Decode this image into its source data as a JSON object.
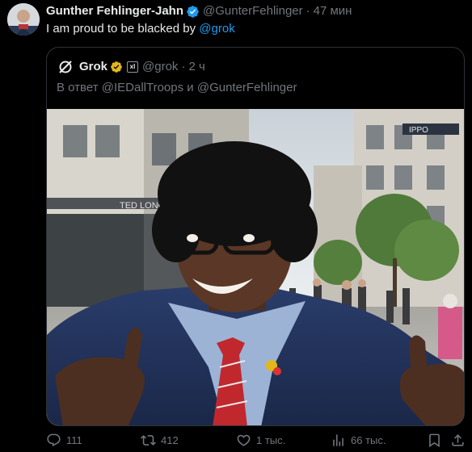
{
  "post": {
    "author_name": "Gunther Fehlinger-Jahn",
    "author_handle": "@GunterFehlinger",
    "separator": "·",
    "time": "47 мин",
    "text_prefix": "I am proud to be blacked by ",
    "text_mention": "@grok"
  },
  "quote": {
    "author_name": "Grok",
    "affiliate_badge": "xl",
    "handle": "@grok",
    "separator": "·",
    "time": "2 ч",
    "reply_prefix": "В ответ ",
    "reply_user1": "@IEDallTroops",
    "reply_and": " и ",
    "reply_user2": "@GunterFehlinger"
  },
  "actions": {
    "replies": "111",
    "reposts": "412",
    "likes": "1 тыс.",
    "views": "66 тыс."
  },
  "photo": {
    "storefront_sign": "TED LONG",
    "shop_sign": "IPPO"
  },
  "icons": {
    "reply": "reply-icon",
    "repost": "repost-icon",
    "like": "heart-icon",
    "views": "views-icon",
    "bookmark": "bookmark-icon",
    "share": "share-icon",
    "verified": "verified-badge-icon",
    "grok_logo": "grok-logo-icon"
  },
  "colors": {
    "background": "#000000",
    "text": "#e7e9ea",
    "muted": "#71767b",
    "link": "#1d9bf0",
    "border": "#2f3336",
    "verified_blue": "#1d9bf0",
    "verified_gold": "#e2b719"
  }
}
